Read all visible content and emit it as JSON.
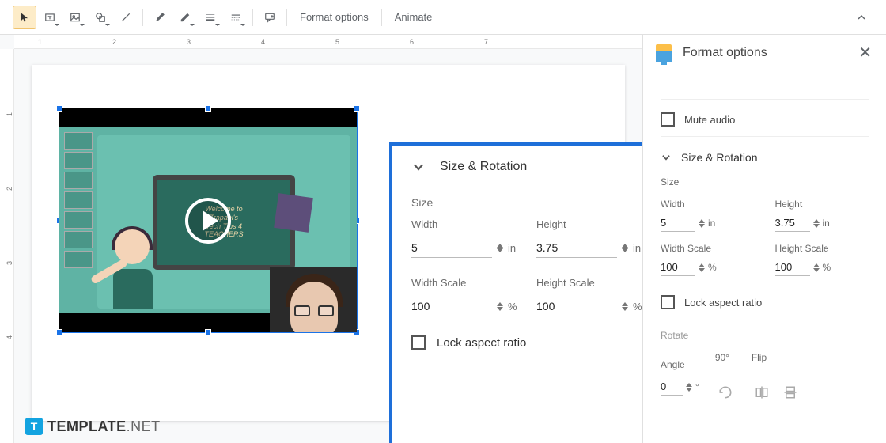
{
  "toolbar": {
    "format_options": "Format options",
    "animate": "Animate"
  },
  "ruler": {
    "h": [
      "1",
      "2",
      "3",
      "4",
      "5",
      "6",
      "7"
    ],
    "v": [
      "1",
      "2",
      "3",
      "4"
    ]
  },
  "video": {
    "welcome_line1": "Welcome to",
    "welcome_line2": "Trapani's",
    "welcome_line3": "Tech Tips 4",
    "welcome_line4": "TEACHERS"
  },
  "popup": {
    "title": "Size & Rotation",
    "size_label": "Size",
    "width_label": "Width",
    "height_label": "Height",
    "width_value": "5",
    "height_value": "3.75",
    "unit_in": "in",
    "width_scale_label": "Width Scale",
    "height_scale_label": "Height Scale",
    "width_scale_value": "100",
    "height_scale_value": "100",
    "unit_pct": "%",
    "lock_ar": "Lock aspect ratio"
  },
  "sidebar": {
    "title": "Format options",
    "mute_audio": "Mute audio",
    "size_rotation": "Size & Rotation",
    "size_label": "Size",
    "width_label": "Width",
    "height_label": "Height",
    "width_value": "5",
    "height_value": "3.75",
    "unit_in": "in",
    "width_scale_label": "Width Scale",
    "height_scale_label": "Height Scale",
    "width_scale_value": "100",
    "height_scale_value": "100",
    "unit_pct": "%",
    "lock_ar": "Lock aspect ratio",
    "rotate_label": "Rotate",
    "angle_label": "Angle",
    "angle_value": "0",
    "angle_unit": "°",
    "ninety": "90°",
    "flip": "Flip"
  },
  "brand": {
    "t": "T",
    "name": "TEMPLATE",
    "net": ".NET"
  }
}
